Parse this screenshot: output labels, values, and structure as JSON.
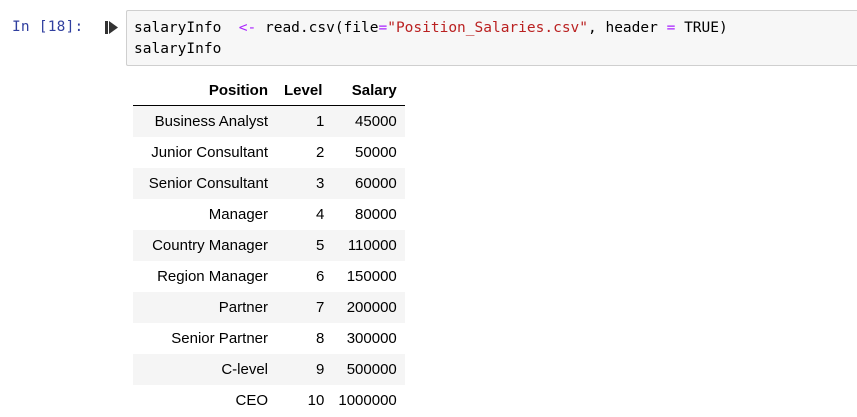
{
  "cell": {
    "prompt": "In [18]:",
    "code_line1": {
      "var": "salaryInfo",
      "assign": "<-",
      "call_open": "read.csv(file",
      "eq1": "=",
      "filename": "\"Position_Salaries.csv\"",
      "comma": ", header",
      "eq2": "=",
      "value": "TRUE)"
    },
    "code_line2": "salaryInfo"
  },
  "table": {
    "headers": [
      "Position",
      "Level",
      "Salary"
    ],
    "rows": [
      {
        "position": "Business Analyst",
        "level": "1",
        "salary": "45000"
      },
      {
        "position": "Junior Consultant",
        "level": "2",
        "salary": "50000"
      },
      {
        "position": "Senior Consultant",
        "level": "3",
        "salary": "60000"
      },
      {
        "position": "Manager",
        "level": "4",
        "salary": "80000"
      },
      {
        "position": "Country Manager",
        "level": "5",
        "salary": "110000"
      },
      {
        "position": "Region Manager",
        "level": "6",
        "salary": "150000"
      },
      {
        "position": "Partner",
        "level": "7",
        "salary": "200000"
      },
      {
        "position": "Senior Partner",
        "level": "8",
        "salary": "300000"
      },
      {
        "position": "C-level",
        "level": "9",
        "salary": "500000"
      },
      {
        "position": "CEO",
        "level": "10",
        "salary": "1000000"
      }
    ]
  },
  "icons": {
    "run": "run-cell-icon"
  },
  "colors": {
    "prompt": "#303f9f",
    "operator": "#aa22ff",
    "string": "#ba2121",
    "input_bg": "#f7f7f7",
    "row_stripe": "#f5f5f5"
  }
}
